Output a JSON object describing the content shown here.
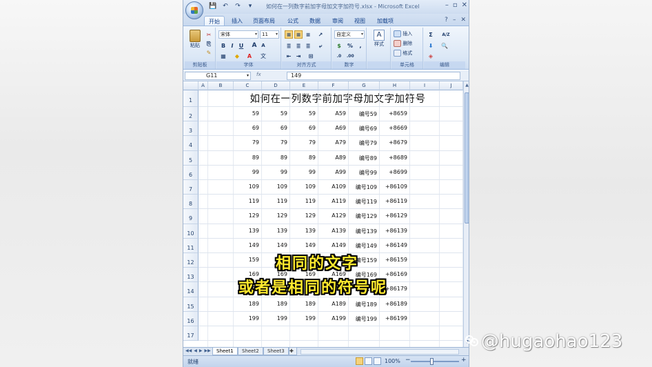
{
  "window": {
    "title": "如何在一列数字前加字母加文字加符号.xlsx - Microsoft Excel",
    "controls": [
      "–",
      "▫",
      "✕"
    ]
  },
  "quick_access": [
    "💾",
    "↶",
    "↷",
    "▾"
  ],
  "ribbon_tabs": [
    "开始",
    "插入",
    "页面布局",
    "公式",
    "数据",
    "审阅",
    "视图",
    "加载项"
  ],
  "ribbon": {
    "clipboard": {
      "paste": "粘贴",
      "label": "剪贴板"
    },
    "font": {
      "name": "宋体",
      "size": "11",
      "label": "字体",
      "bold": "B",
      "italic": "I",
      "underline": "U",
      "grow": "A",
      "shrink": "A"
    },
    "alignment": {
      "label": "对齐方式"
    },
    "number": {
      "format": "自定义",
      "percent": "%",
      "label": "数字"
    },
    "styles": {
      "style": "样式"
    },
    "cells": {
      "insert": "插入",
      "delete": "删除",
      "format": "格式",
      "label": "单元格"
    },
    "editing": {
      "sum": "Σ",
      "sort": "A/Z",
      "find": "🔍",
      "label": "编辑"
    }
  },
  "formula_bar": {
    "name_box": "G11",
    "fx": "fx",
    "value": "149"
  },
  "columns": [
    "A",
    "B",
    "C",
    "D",
    "E",
    "F",
    "G",
    "H",
    "I",
    "J"
  ],
  "sheet": {
    "title": "如何在一列数字前加字母加文字加符号",
    "row_numbers": [
      "1",
      "2",
      "3",
      "4",
      "5",
      "6",
      "7",
      "8",
      "9",
      "10",
      "11",
      "12",
      "13",
      "14",
      "15",
      "16",
      "17"
    ],
    "rows": [
      [
        "59",
        "59",
        "59",
        "A59",
        "编号59",
        "+8659"
      ],
      [
        "69",
        "69",
        "69",
        "A69",
        "编号69",
        "+8669"
      ],
      [
        "79",
        "79",
        "79",
        "A79",
        "编号79",
        "+8679"
      ],
      [
        "89",
        "89",
        "89",
        "A89",
        "编号89",
        "+8689"
      ],
      [
        "99",
        "99",
        "99",
        "A99",
        "编号99",
        "+8699"
      ],
      [
        "109",
        "109",
        "109",
        "A109",
        "编号109",
        "+86109"
      ],
      [
        "119",
        "119",
        "119",
        "A119",
        "编号119",
        "+86119"
      ],
      [
        "129",
        "129",
        "129",
        "A129",
        "编号129",
        "+86129"
      ],
      [
        "139",
        "139",
        "139",
        "A139",
        "编号139",
        "+86139"
      ],
      [
        "149",
        "149",
        "149",
        "A149",
        "编号149",
        "+86149"
      ],
      [
        "159",
        "159",
        "159",
        "A159",
        "编号159",
        "+86159"
      ],
      [
        "169",
        "169",
        "169",
        "A169",
        "编号169",
        "+86169"
      ],
      [
        "179",
        "179",
        "179",
        "A179",
        "编号179",
        "+86179"
      ],
      [
        "189",
        "189",
        "189",
        "A189",
        "编号189",
        "+86189"
      ],
      [
        "199",
        "199",
        "199",
        "A199",
        "编号199",
        "+86199"
      ]
    ]
  },
  "sheet_tabs": [
    "Sheet1",
    "Sheet2",
    "Sheet3"
  ],
  "status": {
    "text": "就绪",
    "zoom": "100%"
  },
  "subtitles": {
    "line1": "相同的文字",
    "line2": "或者是相同的符号呢"
  },
  "watermark": "@hugaohao123"
}
